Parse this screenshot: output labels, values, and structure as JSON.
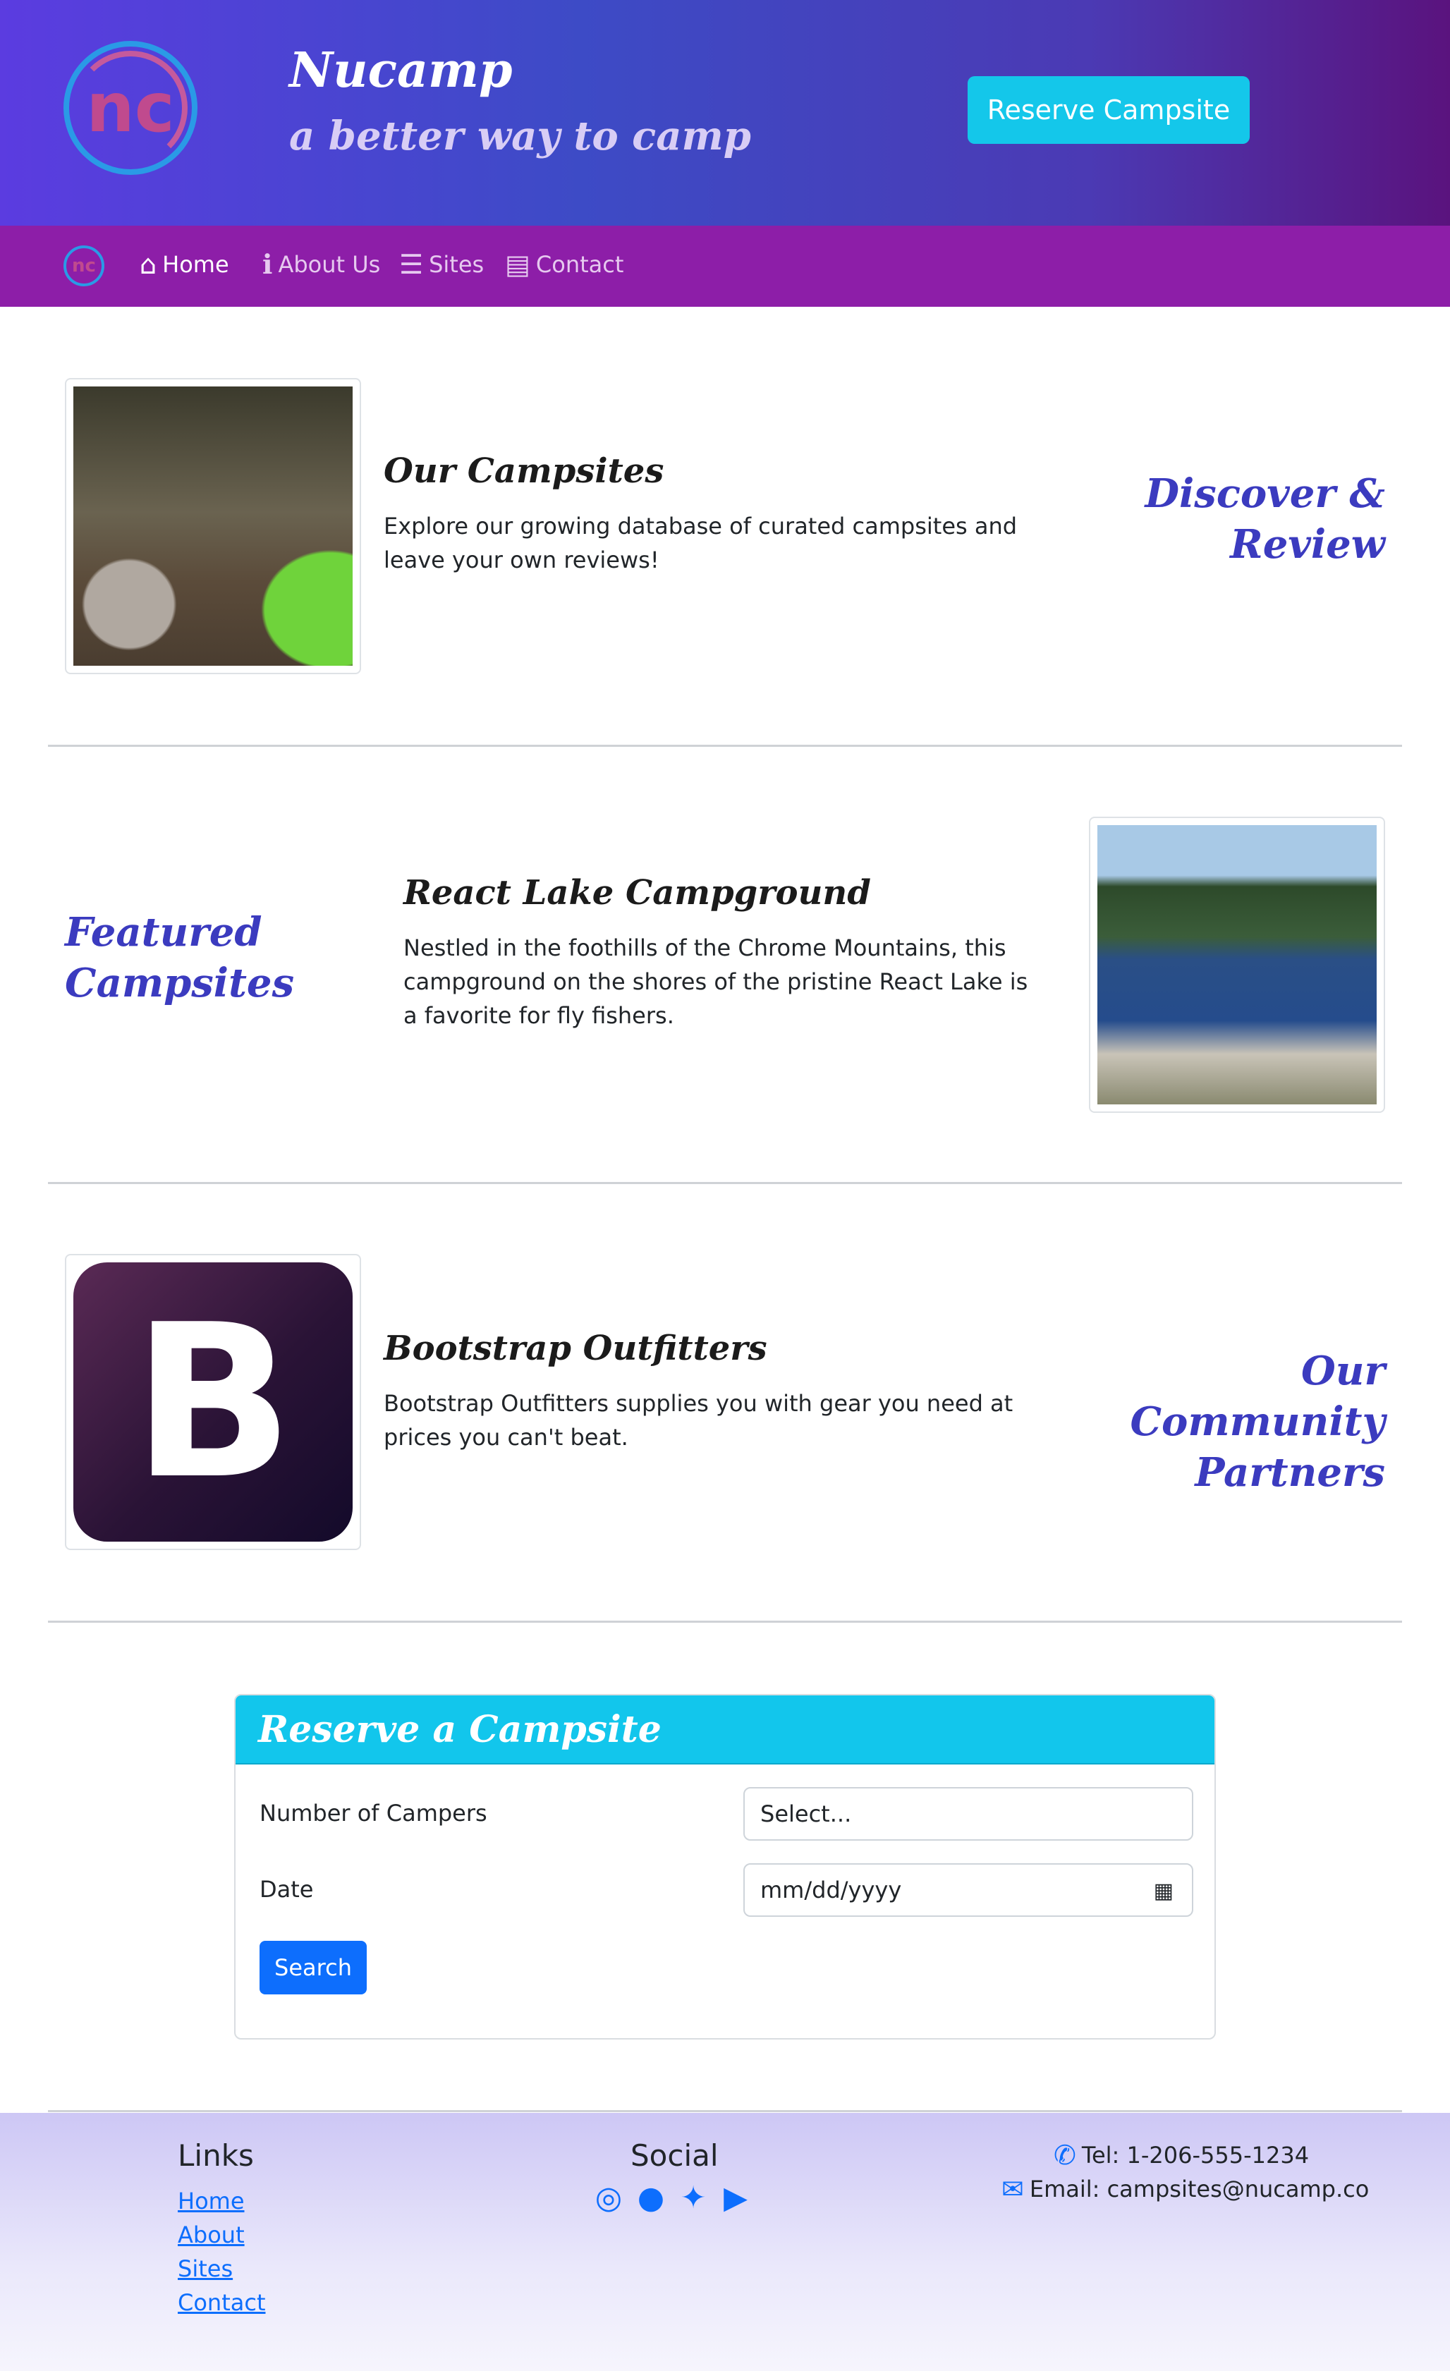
{
  "header": {
    "title": "Nucamp",
    "subtitle": "a better way to camp",
    "logo_text": "nc",
    "reserve_button": "Reserve Campsite"
  },
  "nav": {
    "logo_text": "nc",
    "items": [
      {
        "label": "Home",
        "icon": "home-icon"
      },
      {
        "label": "About Us",
        "icon": "info-icon"
      },
      {
        "label": "Sites",
        "icon": "list-icon"
      },
      {
        "label": "Contact",
        "icon": "address-card-icon"
      }
    ]
  },
  "sections": [
    {
      "title": "Our Campsites",
      "text": "Explore our growing database of curated campsites and leave your own reviews!",
      "side_title": "Discover & Review"
    },
    {
      "title": "React Lake Campground",
      "text": "Nestled in the foothills of the Chrome Mountains, this campground on the shores of the pristine React Lake is a favorite for fly fishers.",
      "side_title": "Featured Campsites"
    },
    {
      "title": "Bootstrap Outfitters",
      "text": "Bootstrap Outfitters supplies you with gear you need at prices you can't beat.",
      "side_title": "Our Community Partners",
      "logo_letter": "B"
    }
  ],
  "reserve": {
    "title": "Reserve a Campsite",
    "campers_label": "Number of Campers",
    "campers_value": "Select...",
    "date_label": "Date",
    "date_placeholder": "mm/dd/yyyy",
    "search_button": "Search"
  },
  "footer": {
    "links_heading": "Links",
    "links": [
      "Home",
      "About",
      "Sites",
      "Contact"
    ],
    "social_heading": "Social",
    "social_icons": [
      "instagram-icon",
      "facebook-icon",
      "twitter-icon",
      "youtube-icon"
    ],
    "tel": "Tel: 1-206-555-1234",
    "email": "Email: campsites@nucamp.co"
  },
  "colors": {
    "nav_bg": "#8d1ea8",
    "accent_cyan": "#12c6ec",
    "link_blue": "#0d6efd",
    "heading_blue": "#3b3bbf"
  }
}
